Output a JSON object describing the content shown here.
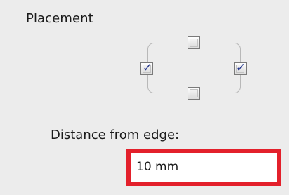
{
  "placement": {
    "title": "Placement",
    "checkboxes": {
      "top": {
        "checked": false
      },
      "left": {
        "checked": true
      },
      "right": {
        "checked": true
      },
      "bottom": {
        "checked": false
      }
    }
  },
  "distance": {
    "label": "Distance from edge:",
    "value": "10 mm"
  },
  "colors": {
    "panel_bg": "#ececec",
    "check": "#23358d",
    "highlight": "#e3202b"
  }
}
